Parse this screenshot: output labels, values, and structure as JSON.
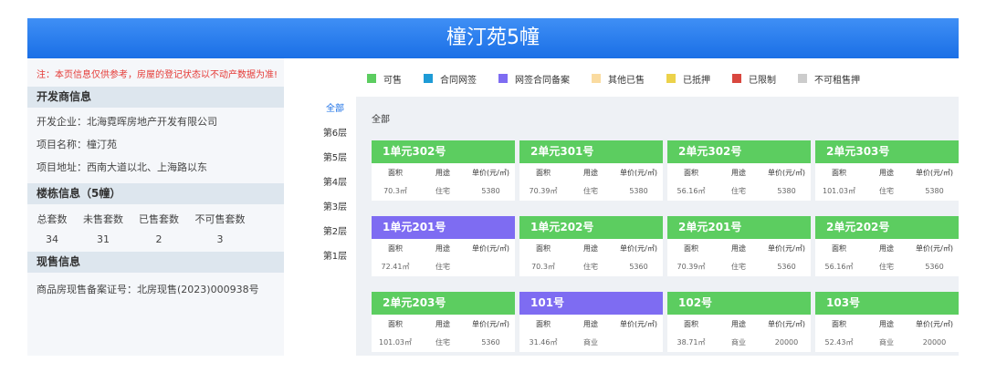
{
  "title": "橦汀苑5幢",
  "notice": "注：本页信息仅供参考，房屋的登记状态以不动产数据为准!",
  "developer": {
    "section_title": "开发商信息",
    "company": "开发企业：北海霓晖房地产开发有限公司",
    "project_name": "项目名称：橦汀苑",
    "project_address": "项目地址：西南大道以北、上海路以东"
  },
  "building": {
    "section_title": "楼栋信息（5幢）",
    "stats": [
      {
        "label": "总套数",
        "value": "34"
      },
      {
        "label": "未售套数",
        "value": "31"
      },
      {
        "label": "已售套数",
        "value": "2"
      },
      {
        "label": "不可售套数",
        "value": "3"
      }
    ]
  },
  "presale": {
    "section_title": "现售信息",
    "record": "商品房现售备案证号：北房现售(2023)000938号"
  },
  "legend": [
    {
      "label": "可售",
      "color": "#5ccd60"
    },
    {
      "label": "合同网签",
      "color": "#1e9bd6"
    },
    {
      "label": "网签合同备案",
      "color": "#7e6cf2"
    },
    {
      "label": "其他已售",
      "color": "#fadba0"
    },
    {
      "label": "已抵押",
      "color": "#ecd24a"
    },
    {
      "label": "已限制",
      "color": "#d9473f"
    },
    {
      "label": "不可租售押",
      "color": "#cccccc"
    }
  ],
  "floors": [
    "全部",
    "第6层",
    "第5层",
    "第4层",
    "第3层",
    "第2层",
    "第1层"
  ],
  "content_title": "全部",
  "col_headers": {
    "area": "面积",
    "use": "用途",
    "price": "单价(元/㎡)"
  },
  "units": [
    {
      "name": "1单元302号",
      "area": "70.3㎡",
      "use": "住宅",
      "price": "5380",
      "color": "#5ccd60"
    },
    {
      "name": "2单元301号",
      "area": "70.39㎡",
      "use": "住宅",
      "price": "5380",
      "color": "#5ccd60"
    },
    {
      "name": "2单元302号",
      "area": "56.16㎡",
      "use": "住宅",
      "price": "5380",
      "color": "#5ccd60"
    },
    {
      "name": "2单元303号",
      "area": "101.03㎡",
      "use": "住宅",
      "price": "5380",
      "color": "#5ccd60"
    },
    {
      "name": "1单元201号",
      "area": "72.41㎡",
      "use": "住宅",
      "price": "",
      "color": "#7e6cf2"
    },
    {
      "name": "1单元202号",
      "area": "70.3㎡",
      "use": "住宅",
      "price": "5360",
      "color": "#5ccd60"
    },
    {
      "name": "2单元201号",
      "area": "70.39㎡",
      "use": "住宅",
      "price": "5360",
      "color": "#5ccd60"
    },
    {
      "name": "2单元202号",
      "area": "56.16㎡",
      "use": "住宅",
      "price": "5360",
      "color": "#5ccd60"
    },
    {
      "name": "2单元203号",
      "area": "101.03㎡",
      "use": "住宅",
      "price": "5360",
      "color": "#5ccd60"
    },
    {
      "name": "101号",
      "area": "31.46㎡",
      "use": "商业",
      "price": "",
      "color": "#7e6cf2"
    },
    {
      "name": "102号",
      "area": "38.71㎡",
      "use": "商业",
      "price": "20000",
      "color": "#5ccd60"
    },
    {
      "name": "103号",
      "area": "52.43㎡",
      "use": "商业",
      "price": "20000",
      "color": "#5ccd60"
    }
  ]
}
